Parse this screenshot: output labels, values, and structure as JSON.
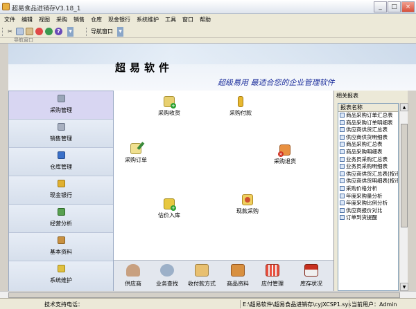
{
  "window": {
    "title": "超易食品进销存V3.18_1",
    "buttons": [
      "_",
      "□",
      "×"
    ]
  },
  "menu": [
    "文件",
    "编辑",
    "视图",
    "采购",
    "销售",
    "仓库",
    "现金银行",
    "系统维护",
    "工具",
    "窗口",
    "帮助"
  ],
  "toolbar": {
    "nav_window_label": "导航窗口"
  },
  "nav_strip": {
    "label": "导航窗口"
  },
  "banner": {
    "brand": "超易软件",
    "slogan": "超级易用 最适合您的企业管理软件"
  },
  "sidebar": [
    {
      "label": "采购管理",
      "active": true
    },
    {
      "label": "销售管理"
    },
    {
      "label": "仓库管理"
    },
    {
      "label": "现金银行"
    },
    {
      "label": "经营分析"
    },
    {
      "label": "基本资料"
    },
    {
      "label": "系统维护"
    }
  ],
  "workflow": [
    {
      "label": "采购收货",
      "icon": "purchase-receipt-icon"
    },
    {
      "label": "采购付款",
      "icon": "purchase-payment-icon"
    },
    {
      "label": "采购订单",
      "icon": "purchase-order-icon"
    },
    {
      "label": "采购退货",
      "icon": "purchase-return-icon"
    },
    {
      "label": "估价入库",
      "icon": "valuation-stock-in-icon"
    },
    {
      "label": "现款采购",
      "icon": "cash-purchase-icon"
    }
  ],
  "quickbar": [
    {
      "label": "供应商",
      "icon": "supplier-icon"
    },
    {
      "label": "业务查找",
      "icon": "business-search-icon"
    },
    {
      "label": "收付款方式",
      "icon": "payment-method-icon"
    },
    {
      "label": "商品资料",
      "icon": "product-data-icon"
    },
    {
      "label": "应付管理",
      "icon": "payables-icon"
    },
    {
      "label": "库存状况",
      "icon": "inventory-status-icon"
    }
  ],
  "reports": {
    "title": "相关报表",
    "column": "报表名称",
    "items": [
      "商品采购订单汇总表",
      "商品采购订单明细表",
      "供应商供货汇总表",
      "供应商供货明细表",
      "商品采购汇总表",
      "商品采购明细表",
      "业务员采购汇总表",
      "业务员采购明细表",
      "供应商供货汇总表(按币种)",
      "供应商供货明细表(按币种)",
      "采购价格分析",
      "年度采购量分析",
      "年度采购比例分析",
      "供应商报价对比",
      "订单到货提醒"
    ]
  },
  "status": {
    "support_label": "技术支持电话：",
    "path": "E:\\超易软件\\超易食品进销存\\cyJXCSP1.sys",
    "user": "当前用户：Admin"
  }
}
